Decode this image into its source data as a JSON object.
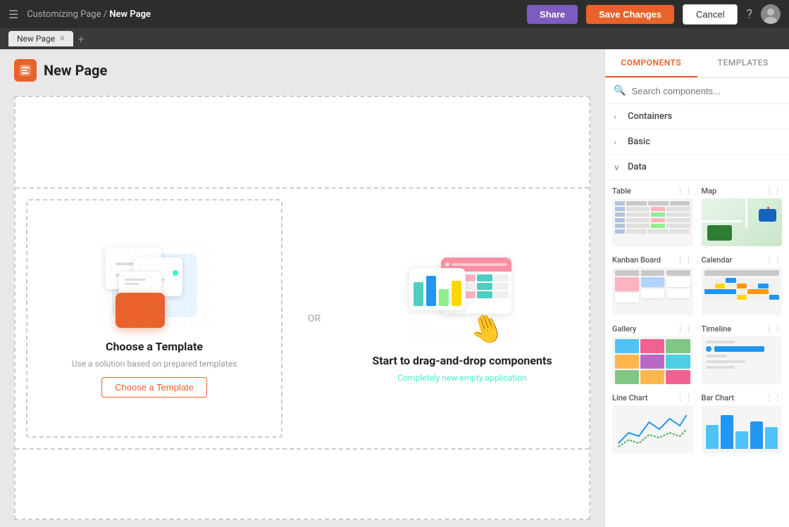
{
  "navbar": {
    "breadcrumb_parent": "Customizing Page",
    "breadcrumb_current": "New Page",
    "share_label": "Share",
    "save_label": "Save Changes",
    "cancel_label": "Cancel"
  },
  "tab_bar": {
    "tab_label": "New Page"
  },
  "page": {
    "title": "New Page"
  },
  "canvas": {
    "choose_template_title": "Choose a Template",
    "choose_template_sub": "Use a solution based on prepared templates",
    "choose_template_btn": "Choose a Template",
    "or_label": "OR",
    "drag_title": "Start to drag-and-drop components",
    "drag_sub": "Completely new empty application"
  },
  "sidebar": {
    "tab_components": "COMPONENTS",
    "tab_templates": "TEMPLATES",
    "search_placeholder": "Search components...",
    "categories": [
      {
        "label": "Containers",
        "expanded": false
      },
      {
        "label": "Basic",
        "expanded": false
      },
      {
        "label": "Data",
        "expanded": true
      }
    ],
    "components": [
      {
        "label": "Table"
      },
      {
        "label": "Map"
      },
      {
        "label": "Kanban Board"
      },
      {
        "label": "Calendar"
      },
      {
        "label": "Gallery"
      },
      {
        "label": "Timeline"
      },
      {
        "label": "Line Chart"
      },
      {
        "label": "Bar Chart"
      }
    ]
  }
}
